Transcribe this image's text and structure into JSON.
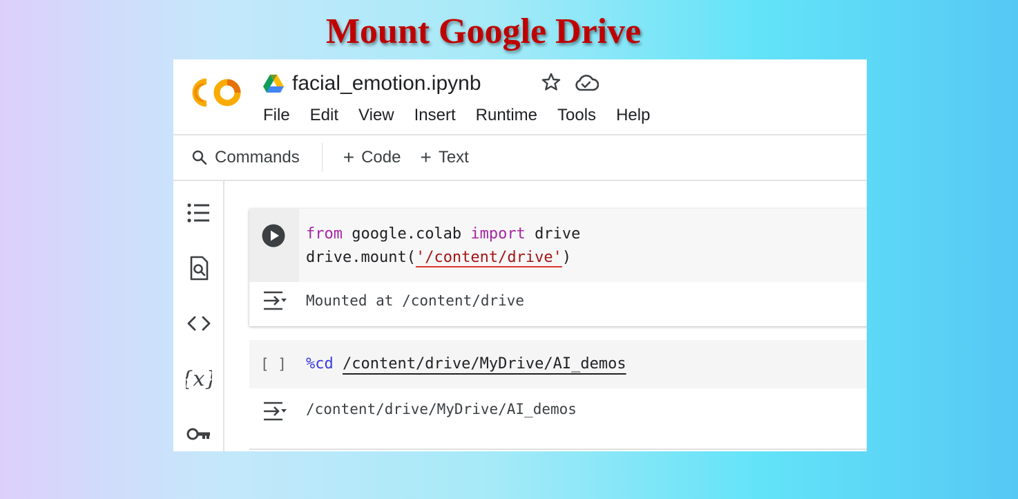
{
  "slide": {
    "title": "Mount Google Drive"
  },
  "header": {
    "logo_text": "CO",
    "file_name": "facial_emotion.ipynb",
    "icons": [
      "colab-logo",
      "google-drive-icon",
      "star-icon",
      "cloud-saved-icon"
    ]
  },
  "menu": {
    "items": [
      "File",
      "Edit",
      "View",
      "Insert",
      "Runtime",
      "Tools",
      "Help"
    ]
  },
  "toolbar": {
    "commands_label": "Commands",
    "code_label": "Code",
    "text_label": "Text",
    "plus": "+"
  },
  "sidebar": {
    "icons": [
      "table-of-contents-icon",
      "find-icon",
      "code-snippets-icon",
      "variables-icon",
      "secrets-key-icon"
    ]
  },
  "cells": [
    {
      "code_line1": {
        "from": "from",
        "module": " google.colab ",
        "import": "import",
        "name": " drive"
      },
      "code_line2": {
        "call": "drive.mount(",
        "arg": "'/content/drive'",
        "close": ")"
      },
      "output": "Mounted at /content/drive"
    },
    {
      "bracket": "[ ]",
      "magic": "%cd",
      "path": "/content/drive/MyDrive/AI_demos",
      "output": "/content/drive/MyDrive/AI_demos"
    }
  ],
  "colors": {
    "title": "#c00000",
    "keyword": "#a626a4",
    "magic": "#3b3bdf",
    "string": "#a31515",
    "logo_orange": "#f9ab00",
    "logo_dark_orange": "#e8710a"
  }
}
